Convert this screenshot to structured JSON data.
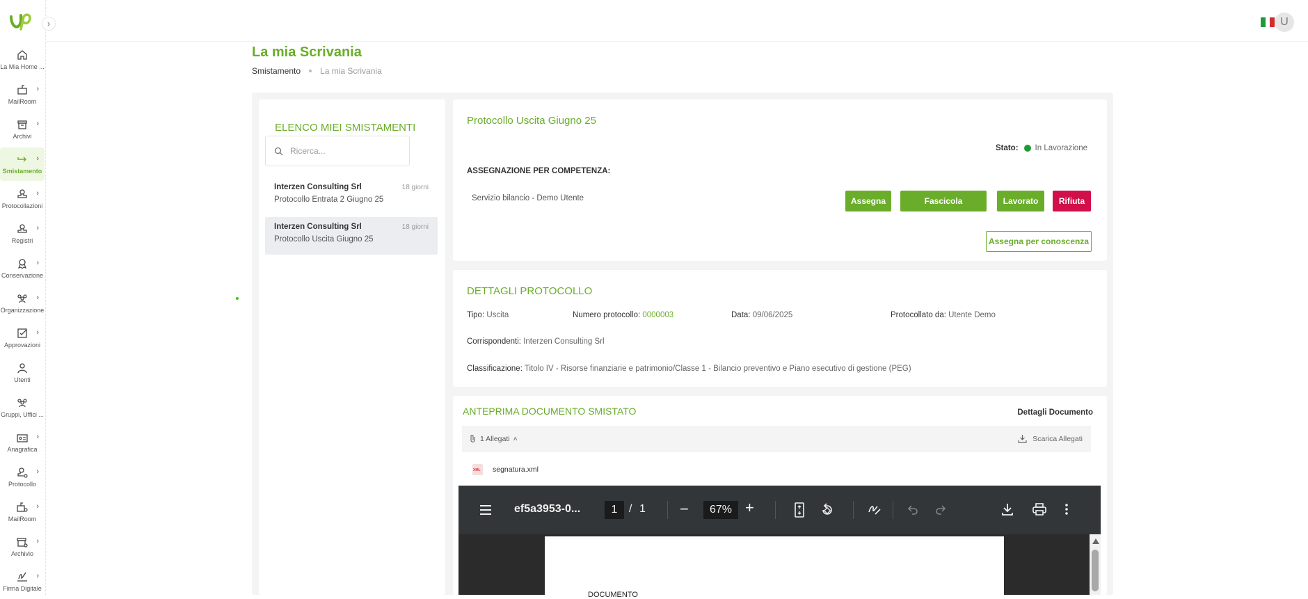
{
  "sidebar": {
    "items": [
      {
        "label": "La Mia Home ...",
        "icon": "home-icon"
      },
      {
        "label": "MailRoom",
        "icon": "mailbox-icon"
      },
      {
        "label": "Archivi",
        "icon": "archive-icon"
      },
      {
        "label": "Smistamento",
        "icon": "forward-icon"
      },
      {
        "label": "Protocollazioni",
        "icon": "stamp-icon"
      },
      {
        "label": "Registri",
        "icon": "stamp-icon"
      },
      {
        "label": "Conservazione",
        "icon": "badge-icon"
      },
      {
        "label": "Organizzazione",
        "icon": "people-icon"
      },
      {
        "label": "Approvazioni",
        "icon": "checkbox-icon"
      },
      {
        "label": "Utenti",
        "icon": "user-icon"
      },
      {
        "label": "Gruppi, Uffici ...",
        "icon": "people-icon"
      },
      {
        "label": "Anagrafica",
        "icon": "id-card-icon"
      },
      {
        "label": "Protocollo",
        "icon": "stamp-gear-icon"
      },
      {
        "label": "MailRoom",
        "icon": "mailbox-gear-icon"
      },
      {
        "label": "Archivio",
        "icon": "archive-gear-icon"
      },
      {
        "label": "Firma Digitale",
        "icon": "signature-icon"
      }
    ]
  },
  "header": {
    "avatar_initial": "U",
    "language": "IT"
  },
  "page": {
    "title": "La mia Scrivania",
    "breadcrumb": [
      "Smistamento",
      "La mia Scrivania"
    ]
  },
  "list": {
    "title": "ELENCO MIEI SMISTAMENTI",
    "search_placeholder": "Ricerca...",
    "items": [
      {
        "name": "Interzen Consulting Srl",
        "subject": "Protocollo Entrata 2 Giugno 25",
        "age": "18 giorni"
      },
      {
        "name": "Interzen Consulting Srl",
        "subject": "Protocollo Uscita Giugno 25",
        "age": "18 giorni"
      }
    ]
  },
  "detail": {
    "title": "Protocollo Uscita Giugno 25",
    "stato_label": "Stato:",
    "stato_value": "In Lavorazione",
    "assign_heading": "ASSEGNAZIONE PER COMPETENZA:",
    "assignee": "Servizio bilancio - Demo Utente",
    "buttons": {
      "assegna": "Assegna",
      "fascicola": "Fascicola",
      "lavorato": "Lavorato",
      "rifiuta": "Rifiuta",
      "conoscenza": "Assegna per conoscenza"
    }
  },
  "protocol": {
    "title": "DETTAGLI PROTOCOLLO",
    "tipo_label": "Tipo:",
    "tipo": "Uscita",
    "numero_label": "Numero protocollo:",
    "numero": "0000003",
    "data_label": "Data:",
    "data": "09/06/2025",
    "da_label": "Protocollato da:",
    "da": "Utente Demo",
    "corr_label": "Corrispondenti:",
    "corr": "Interzen Consulting Srl",
    "class_label": "Classificazione:",
    "class": "Titolo IV - Risorse finanziarie e patrimonio/Classe 1 - Bilancio preventivo e Piano esecutivo di gestione (PEG)"
  },
  "preview": {
    "title": "ANTEPRIMA DOCUMENTO SMISTATO",
    "details_link": "Dettagli Documento",
    "attachments": "1 Allegati",
    "download_all": "Scarica Allegati",
    "file": "segnatura.xml",
    "file_badge": "XML"
  },
  "pdf": {
    "filename": "ef5a3953-0...",
    "page": "1",
    "sep": "/",
    "pages": "1",
    "zoom": "67%",
    "doc_text": "DOCUMENTO"
  },
  "colors": {
    "accent": "#6aad2a",
    "danger": "#d10f49",
    "status_ok": "#1c9b31"
  }
}
